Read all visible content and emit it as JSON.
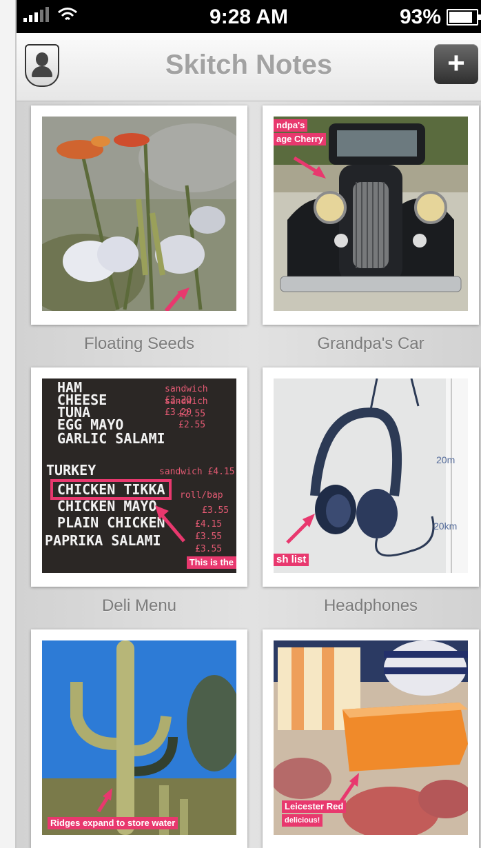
{
  "status_bar": {
    "time": "9:28 AM",
    "battery": "93%",
    "battery_level": 0.93
  },
  "navbar": {
    "title": "Skitch Notes",
    "add_label": "+",
    "profile_icon": "person-silhouette-icon"
  },
  "notes": [
    {
      "caption": "Floating Seeds",
      "annotations": []
    },
    {
      "caption": "Grandpa's Car",
      "annotations": [
        "ndpa's",
        "age Cherry"
      ]
    },
    {
      "caption": "Deli Menu",
      "annotations": [
        "This is the"
      ],
      "menu_lines": [
        "HAM",
        "CHEESE",
        "TUNA",
        "EGG MAYO",
        "GARLIC SALAMI",
        "TURKEY",
        "CHICKEN TIKKA",
        "CHICKEN MAYO",
        "PLAIN CHICKEN",
        "PAPRIKA SALAMI"
      ],
      "menu_prices": [
        "sandwich £3.20",
        "sandwich £3.20",
        "£2.55",
        "£2.55",
        "sandwich £4.15",
        "roll/bap",
        "£3.55",
        "£4.15",
        "£3.55",
        "£3.55"
      ]
    },
    {
      "caption": "Headphones",
      "annotations": [
        "sh list"
      ],
      "scale_labels": [
        "20m",
        "20km"
      ]
    },
    {
      "caption": "",
      "annotations": [
        "Ridges expand to store water"
      ]
    },
    {
      "caption": "",
      "annotations": [
        "Leicester Red",
        "delicious!"
      ]
    }
  ],
  "colors": {
    "annotation": "#e8386e",
    "navbar_title": "#a2a2a2"
  }
}
